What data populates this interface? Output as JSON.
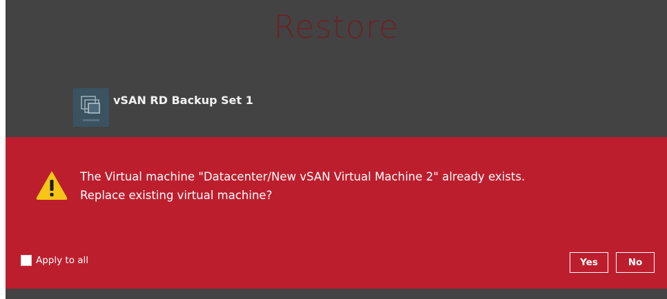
{
  "window": {
    "title": "Restore"
  },
  "backup_set": {
    "name": "vSAN RD Backup Set 1",
    "icon": "vsan-backup-icon"
  },
  "dialog": {
    "icon": "warning-icon",
    "message_line1": "The Virtual machine \"Datacenter/New vSAN Virtual Machine 2\" already exists.",
    "message_line2": "Replace existing virtual machine?",
    "apply_to_all_label": "Apply to all",
    "apply_to_all_checked": false,
    "yes_label": "Yes",
    "no_label": "No"
  },
  "colors": {
    "overlay_background": "#434343",
    "dialog_background": "#bd1e2d",
    "title_color": "#6b2226",
    "warning_yellow": "#f5c518"
  }
}
